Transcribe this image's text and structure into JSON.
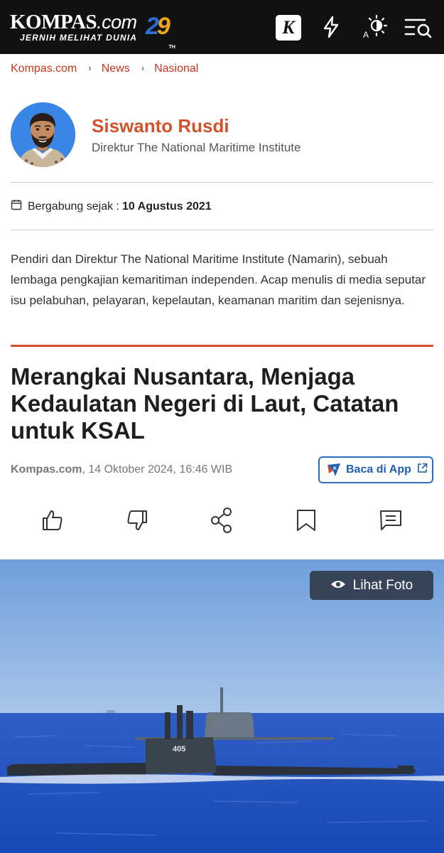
{
  "header": {
    "logo_main": "KOMPAS",
    "logo_dotcom": ".com",
    "logo_tagline": "JERNIH MELIHAT DUNIA",
    "anniversary": {
      "digit1": "2",
      "digit2": "9",
      "suffix": "TH"
    },
    "kompas_k": "K",
    "icons": [
      "kompas-k-icon",
      "flash-icon",
      "theme-brightness-icon",
      "menu-search-icon"
    ]
  },
  "breadcrumb": [
    "Kompas.com",
    "News",
    "Nasional"
  ],
  "author": {
    "name": "Siswanto Rusdi",
    "role": "Direktur The National Maritime Institute",
    "joined_label": "Bergabung sejak :",
    "joined_date": "10 Agustus 2021",
    "bio": "Pendiri dan Direktur The National Maritime Institute (Namarin), sebuah lembaga pengkajian kemaritiman independen. Acap menulis di media seputar isu pelabuhan, pelayaran, kepelautan, keamanan maritim dan sejenisnya."
  },
  "article": {
    "title": "Merangkai Nusantara, Menjaga Kedaulatan Negeri di Laut, Catatan untuk KSAL",
    "source": "Kompas.com",
    "datetime": ", 14 Oktober 2024, 16:46 WIB",
    "app_button": "Baca di App",
    "actions": [
      "like-icon",
      "dislike-icon",
      "share-icon",
      "bookmark-icon",
      "comment-icon"
    ],
    "photo_button": "Lihat Foto",
    "hull_number": "405"
  },
  "colors": {
    "accent": "#d2532b",
    "breadcrumb": "#c7361c",
    "app_blue": "#2c6fbf",
    "header_bg": "#111111"
  }
}
